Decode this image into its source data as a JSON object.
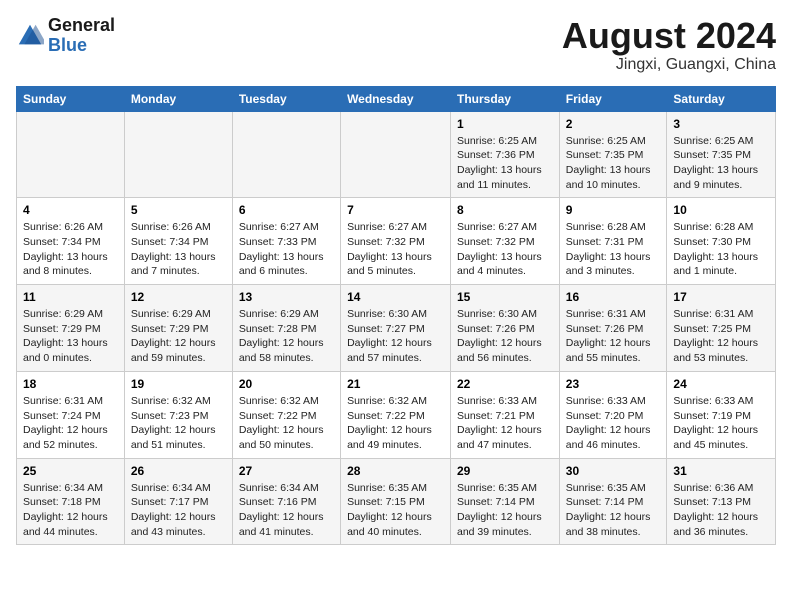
{
  "logo": {
    "text_general": "General",
    "text_blue": "Blue"
  },
  "title": "August 2024",
  "subtitle": "Jingxi, Guangxi, China",
  "days_of_week": [
    "Sunday",
    "Monday",
    "Tuesday",
    "Wednesday",
    "Thursday",
    "Friday",
    "Saturday"
  ],
  "weeks": [
    [
      {
        "num": "",
        "info": ""
      },
      {
        "num": "",
        "info": ""
      },
      {
        "num": "",
        "info": ""
      },
      {
        "num": "",
        "info": ""
      },
      {
        "num": "1",
        "info": "Sunrise: 6:25 AM\nSunset: 7:36 PM\nDaylight: 13 hours and 11 minutes."
      },
      {
        "num": "2",
        "info": "Sunrise: 6:25 AM\nSunset: 7:35 PM\nDaylight: 13 hours and 10 minutes."
      },
      {
        "num": "3",
        "info": "Sunrise: 6:25 AM\nSunset: 7:35 PM\nDaylight: 13 hours and 9 minutes."
      }
    ],
    [
      {
        "num": "4",
        "info": "Sunrise: 6:26 AM\nSunset: 7:34 PM\nDaylight: 13 hours and 8 minutes."
      },
      {
        "num": "5",
        "info": "Sunrise: 6:26 AM\nSunset: 7:34 PM\nDaylight: 13 hours and 7 minutes."
      },
      {
        "num": "6",
        "info": "Sunrise: 6:27 AM\nSunset: 7:33 PM\nDaylight: 13 hours and 6 minutes."
      },
      {
        "num": "7",
        "info": "Sunrise: 6:27 AM\nSunset: 7:32 PM\nDaylight: 13 hours and 5 minutes."
      },
      {
        "num": "8",
        "info": "Sunrise: 6:27 AM\nSunset: 7:32 PM\nDaylight: 13 hours and 4 minutes."
      },
      {
        "num": "9",
        "info": "Sunrise: 6:28 AM\nSunset: 7:31 PM\nDaylight: 13 hours and 3 minutes."
      },
      {
        "num": "10",
        "info": "Sunrise: 6:28 AM\nSunset: 7:30 PM\nDaylight: 13 hours and 1 minute."
      }
    ],
    [
      {
        "num": "11",
        "info": "Sunrise: 6:29 AM\nSunset: 7:29 PM\nDaylight: 13 hours and 0 minutes."
      },
      {
        "num": "12",
        "info": "Sunrise: 6:29 AM\nSunset: 7:29 PM\nDaylight: 12 hours and 59 minutes."
      },
      {
        "num": "13",
        "info": "Sunrise: 6:29 AM\nSunset: 7:28 PM\nDaylight: 12 hours and 58 minutes."
      },
      {
        "num": "14",
        "info": "Sunrise: 6:30 AM\nSunset: 7:27 PM\nDaylight: 12 hours and 57 minutes."
      },
      {
        "num": "15",
        "info": "Sunrise: 6:30 AM\nSunset: 7:26 PM\nDaylight: 12 hours and 56 minutes."
      },
      {
        "num": "16",
        "info": "Sunrise: 6:31 AM\nSunset: 7:26 PM\nDaylight: 12 hours and 55 minutes."
      },
      {
        "num": "17",
        "info": "Sunrise: 6:31 AM\nSunset: 7:25 PM\nDaylight: 12 hours and 53 minutes."
      }
    ],
    [
      {
        "num": "18",
        "info": "Sunrise: 6:31 AM\nSunset: 7:24 PM\nDaylight: 12 hours and 52 minutes."
      },
      {
        "num": "19",
        "info": "Sunrise: 6:32 AM\nSunset: 7:23 PM\nDaylight: 12 hours and 51 minutes."
      },
      {
        "num": "20",
        "info": "Sunrise: 6:32 AM\nSunset: 7:22 PM\nDaylight: 12 hours and 50 minutes."
      },
      {
        "num": "21",
        "info": "Sunrise: 6:32 AM\nSunset: 7:22 PM\nDaylight: 12 hours and 49 minutes."
      },
      {
        "num": "22",
        "info": "Sunrise: 6:33 AM\nSunset: 7:21 PM\nDaylight: 12 hours and 47 minutes."
      },
      {
        "num": "23",
        "info": "Sunrise: 6:33 AM\nSunset: 7:20 PM\nDaylight: 12 hours and 46 minutes."
      },
      {
        "num": "24",
        "info": "Sunrise: 6:33 AM\nSunset: 7:19 PM\nDaylight: 12 hours and 45 minutes."
      }
    ],
    [
      {
        "num": "25",
        "info": "Sunrise: 6:34 AM\nSunset: 7:18 PM\nDaylight: 12 hours and 44 minutes."
      },
      {
        "num": "26",
        "info": "Sunrise: 6:34 AM\nSunset: 7:17 PM\nDaylight: 12 hours and 43 minutes."
      },
      {
        "num": "27",
        "info": "Sunrise: 6:34 AM\nSunset: 7:16 PM\nDaylight: 12 hours and 41 minutes."
      },
      {
        "num": "28",
        "info": "Sunrise: 6:35 AM\nSunset: 7:15 PM\nDaylight: 12 hours and 40 minutes."
      },
      {
        "num": "29",
        "info": "Sunrise: 6:35 AM\nSunset: 7:14 PM\nDaylight: 12 hours and 39 minutes."
      },
      {
        "num": "30",
        "info": "Sunrise: 6:35 AM\nSunset: 7:14 PM\nDaylight: 12 hours and 38 minutes."
      },
      {
        "num": "31",
        "info": "Sunrise: 6:36 AM\nSunset: 7:13 PM\nDaylight: 12 hours and 36 minutes."
      }
    ]
  ]
}
